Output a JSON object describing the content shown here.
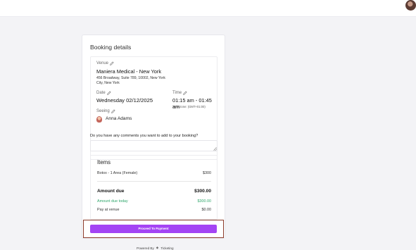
{
  "header": {
    "avatar_icon": "user-avatar"
  },
  "booking": {
    "title": "Booking details",
    "venue": {
      "label": "Venue",
      "name": "Maniera Medical - New York",
      "address_line1": "456 Broadway, Suite 789, 10002, New York",
      "address_line2": "City, New York"
    },
    "date": {
      "label": "Date",
      "value": "Wednesday 02/12/2025"
    },
    "time": {
      "label": "Time",
      "value": "01:15 am - 01:45 am",
      "timezone": "Time zone: (GMT+01:00)"
    },
    "seeing": {
      "label": "Seeing",
      "name": "Anna Adams"
    },
    "comments_question": "Do you have any comments you want to add to your booking?",
    "comments_value": ""
  },
  "items": {
    "title": "Items",
    "lines": [
      {
        "name": "Botox - 1 Area (Female)",
        "price": "$300"
      }
    ],
    "amount_due_label": "Amount due",
    "amount_due_value": "$300.00",
    "due_today_label": "Amount due today",
    "due_today_value": "$300.00",
    "pay_at_venue_label": "Pay at venue",
    "pay_at_venue_value": "$0.00",
    "accent_color": "#2fa66b"
  },
  "cta": {
    "label": "Proceed To Payment",
    "color": "#a444f4"
  },
  "footer": {
    "powered_by": "Powered By",
    "brand": "Ticketing"
  }
}
